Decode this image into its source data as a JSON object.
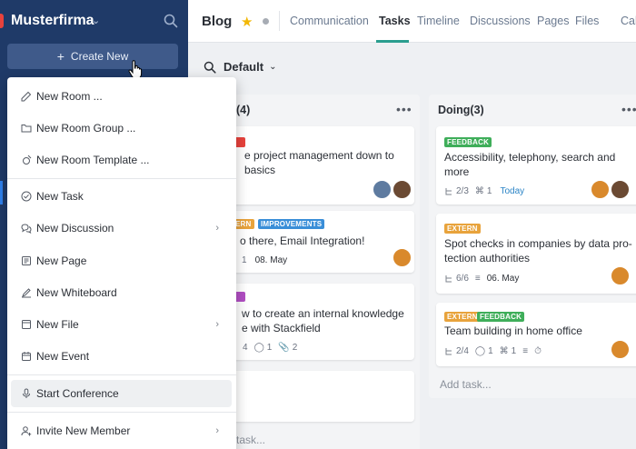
{
  "sidebar": {
    "org_name": "Musterfirma",
    "create_label": "Create New"
  },
  "menu": {
    "items": [
      {
        "label": "New Room ...",
        "icon": "edit-icon",
        "arrow": false
      },
      {
        "label": "New Room Group ...",
        "icon": "folder-icon",
        "arrow": false
      },
      {
        "label": "New Room Template ...",
        "icon": "template-icon",
        "arrow": false
      },
      {
        "label": "New Task",
        "icon": "check-circle-icon",
        "arrow": false
      },
      {
        "label": "New Discussion",
        "icon": "discussion-icon",
        "arrow": true
      },
      {
        "label": "New Page",
        "icon": "page-icon",
        "arrow": false
      },
      {
        "label": "New Whiteboard",
        "icon": "pen-icon",
        "arrow": false
      },
      {
        "label": "New File",
        "icon": "file-icon",
        "arrow": true
      },
      {
        "label": "New Event",
        "icon": "calendar-icon",
        "arrow": false
      },
      {
        "label": "Start Conference",
        "icon": "microphone-icon",
        "arrow": false
      },
      {
        "label": "Invite New Member",
        "icon": "add-user-icon",
        "arrow": true
      }
    ]
  },
  "topbar": {
    "title": "Blog",
    "tabs": [
      "Communication",
      "Tasks",
      "Timeline",
      "Discussions",
      "Pages",
      "Files",
      "Calendar"
    ],
    "active_tab": "Tasks"
  },
  "view": {
    "label": "Default"
  },
  "columns": [
    {
      "title": "(4)",
      "cards": [
        {
          "title_lines": [
            "e project management down to",
            "basics"
          ]
        },
        {
          "tags": [
            "ERN",
            "IMPROVEMENTS"
          ],
          "title_lines": [
            "o there, Email Integration!"
          ],
          "subtasks": "1",
          "date": "08. May"
        },
        {
          "title_lines": [
            "w to create an internal knowledge",
            "e with Stackfield"
          ],
          "subtasks": "4",
          "comments": "1",
          "attachments": "2"
        },
        {}
      ],
      "add_task": "task..."
    },
    {
      "title": "Doing(3)",
      "cards": [
        {
          "tags": [
            "FEEDBACK"
          ],
          "title_lines": [
            "Accessibility, telephony, search and",
            "more"
          ],
          "subtasks": "2/3",
          "attachments": "1",
          "date": "Today"
        },
        {
          "tags": [
            "EXTERN"
          ],
          "title_lines": [
            "Spot checks in companies by data pro-",
            "tection authorities"
          ],
          "subtasks": "6/6",
          "date": "06. May"
        },
        {
          "tags": [
            "EXTERN",
            "FEEDBACK"
          ],
          "title_lines": [
            "Team building in home office"
          ],
          "subtasks": "2/4",
          "comments": "1",
          "attachments": "1"
        }
      ],
      "add_task": "Add task..."
    }
  ],
  "colors": {
    "sidebar": "#1f3a68",
    "feedback_tag": "#3fae5a",
    "extern_tag": "#e8a33c",
    "improvements_tag": "#3a8ed8",
    "accent_green": "#2b9e8f",
    "star": "#f2b705"
  }
}
